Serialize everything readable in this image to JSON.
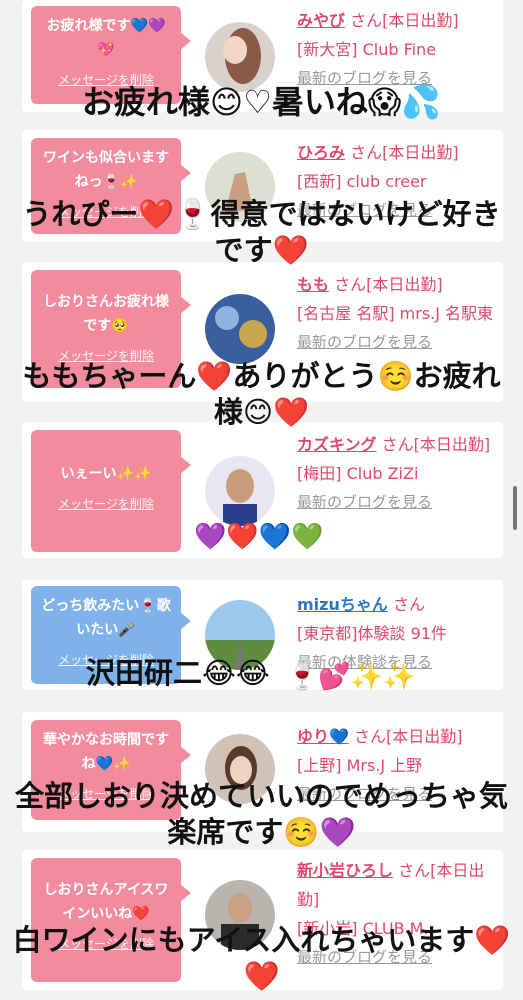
{
  "cards": [
    {
      "bubble": "お疲れ様です💙💜💖",
      "delete": "メッセージを削除",
      "name": "みやび",
      "san": "さん[本日出勤]",
      "shop": "[新大宮] Club Fine",
      "blog": "最新のブログを見る"
    },
    {
      "bubble": "ワインも似合いますねっ🍷✨",
      "delete": "メッセージを削除",
      "name": "ひろみ",
      "san": "さん[本日出勤]",
      "shop": "[西新] club creer",
      "blog": "最新のブログを見る"
    },
    {
      "bubble": "しおりさんお疲れ様です🥺",
      "delete": "メッセージを削除",
      "name": "もも",
      "san": "さん[本日出勤]",
      "shop": "[名古屋 名駅] mrs.J 名駅東",
      "blog": "最新のブログを見る"
    },
    {
      "bubble": "いぇーい✨✨",
      "delete": "メッセージを削除",
      "name": "カズキング",
      "san": "さん[本日出勤]",
      "shop": "[梅田] Club ZiZi",
      "blog": "最新のブログを見る"
    },
    {
      "bubble": "どっち飲みたい🍷歌いたい🎤",
      "delete": "メッセージを削除",
      "name": "mizuちゃん",
      "san": "さん",
      "shop": "[東京都]体験談 91件",
      "blog": "最新の体験談を見る"
    },
    {
      "bubble": "華やかなお時間ですね💙✨",
      "delete": "メッセージを削除",
      "name": "ゆり💙",
      "san": "さん[本日出勤]",
      "shop": "[上野] Mrs.J 上野",
      "blog": "最新のブログを見る"
    },
    {
      "bubble": "しおりさんアイスワインいいね❤️",
      "delete": "メッセージを削除",
      "name": "新小岩ひろし",
      "san": "さん[本日出勤]",
      "shop": "[新小岩] CLUB M.",
      "blog": "最新のブログを見る"
    }
  ],
  "overlays": [
    "お疲れ様😊♡暑いね😱💦",
    "うれぴー❤️🍷得意ではないけど好きです❤️",
    "ももちゃーん❤️ありがとう☺️お疲れ様😊❤️",
    "💜❤️💙💚",
    "沢田研二😂😂",
    "🍷💕✨✨",
    "全部しおり決めていいのでめっちゃ気楽席です☺️💜",
    "白ワインにもアイス入れちゃいます❤️❤️"
  ]
}
